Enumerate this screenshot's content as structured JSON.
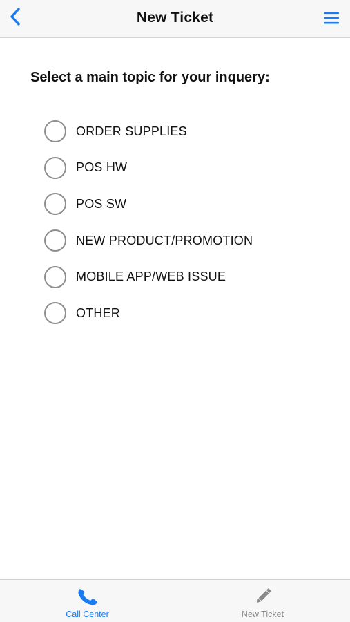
{
  "header": {
    "title": "New Ticket",
    "back_icon": "chevron-left-icon",
    "menu_icon": "hamburger-menu-icon"
  },
  "main": {
    "prompt": "Select a main topic for your inquery:",
    "options": [
      {
        "label": "ORDER SUPPLIES",
        "selected": false
      },
      {
        "label": "POS HW",
        "selected": false
      },
      {
        "label": "POS SW",
        "selected": false
      },
      {
        "label": "NEW PRODUCT/PROMOTION",
        "selected": false
      },
      {
        "label": "MOBILE APP/WEB ISSUE",
        "selected": false
      },
      {
        "label": "OTHER",
        "selected": false
      }
    ]
  },
  "tabbar": {
    "tabs": [
      {
        "label": "Call Center",
        "icon": "phone-icon",
        "active": true
      },
      {
        "label": "New Ticket",
        "icon": "pencil-icon",
        "active": false
      }
    ]
  },
  "colors": {
    "accent": "#1a7cf0",
    "inactive": "#8a8a8a",
    "radio_border": "#8e8e8e",
    "bar_background": "#f7f7f7"
  }
}
